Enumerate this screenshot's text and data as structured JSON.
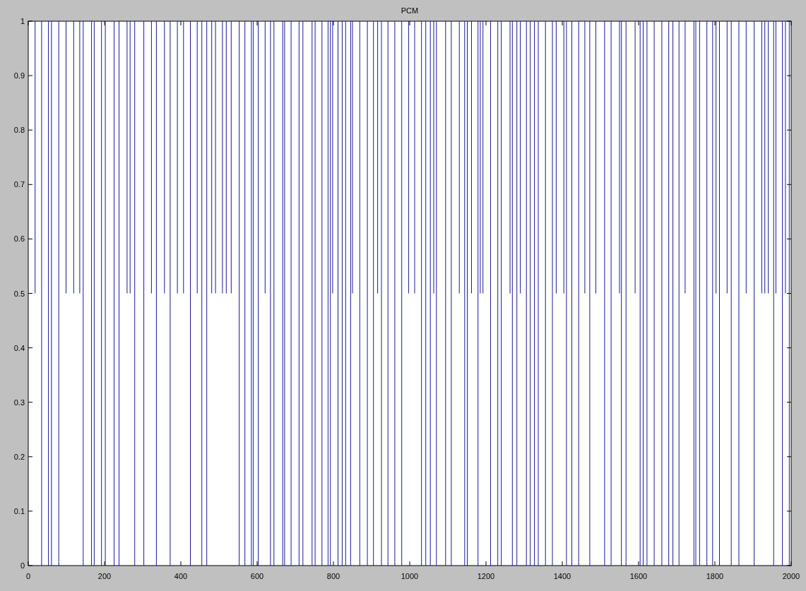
{
  "figure": {
    "title": "PCM",
    "yticks": [
      "1",
      "0.9",
      "0.8",
      "0.7",
      "0.6",
      "0.5",
      "0.4",
      "0.3",
      "0.2",
      "0.1",
      "0"
    ],
    "xticks": [
      "0",
      "200",
      "400",
      "600",
      "800",
      "1000",
      "1200",
      "1400",
      "1600",
      "1800",
      "2000"
    ]
  }
}
